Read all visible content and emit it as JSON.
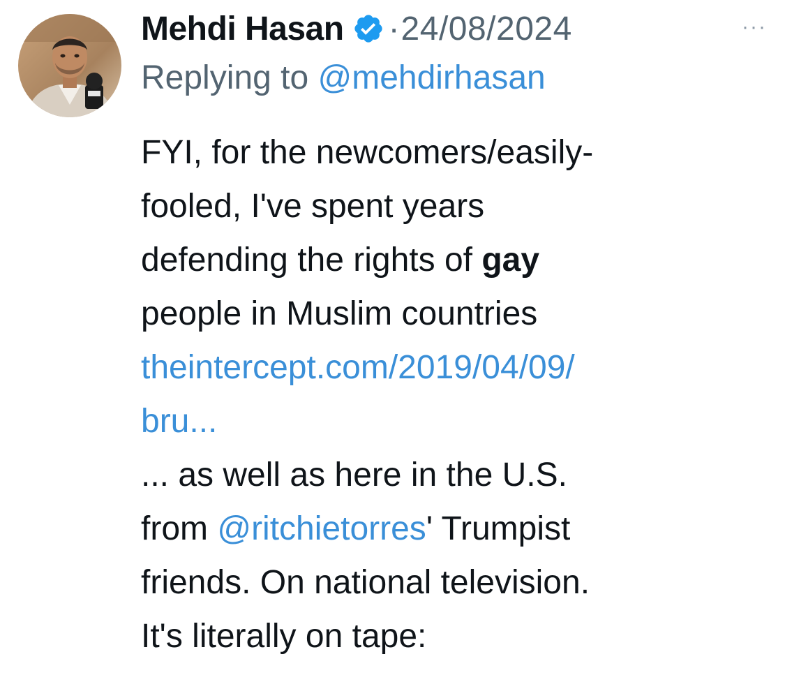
{
  "tweet": {
    "author_name": "Mehdi Hasan",
    "separator": "·",
    "date": "24/08/2024",
    "more_label": "···",
    "replying_prefix": "Replying to",
    "replying_handle": "@mehdirhasan",
    "lines": {
      "l1": "FYI, for the newcomers/easily-",
      "l2": "fooled, I've spent years",
      "l3_pre": "defending the rights of ",
      "l3_bold": "gay",
      "l4": "people in Muslim countries",
      "l5_link": "theintercept.com/2019/04/09/",
      "l6_link": "bru...",
      "l7": "... as well as here in the U.S.",
      "l8_pre": "from ",
      "l8_mention": "@ritchietorres",
      "l8_post": "' Trumpist",
      "l9": "friends. On national television.",
      "l10": "It's literally on tape:"
    }
  },
  "icons": {
    "avatar": "profile-photo",
    "badge": "verified-badge-icon",
    "more": "more-options-icon"
  },
  "colors": {
    "text": "#0f1419",
    "secondary": "#536471",
    "link": "#3a8fd8",
    "verified": "#1d9bf0"
  }
}
